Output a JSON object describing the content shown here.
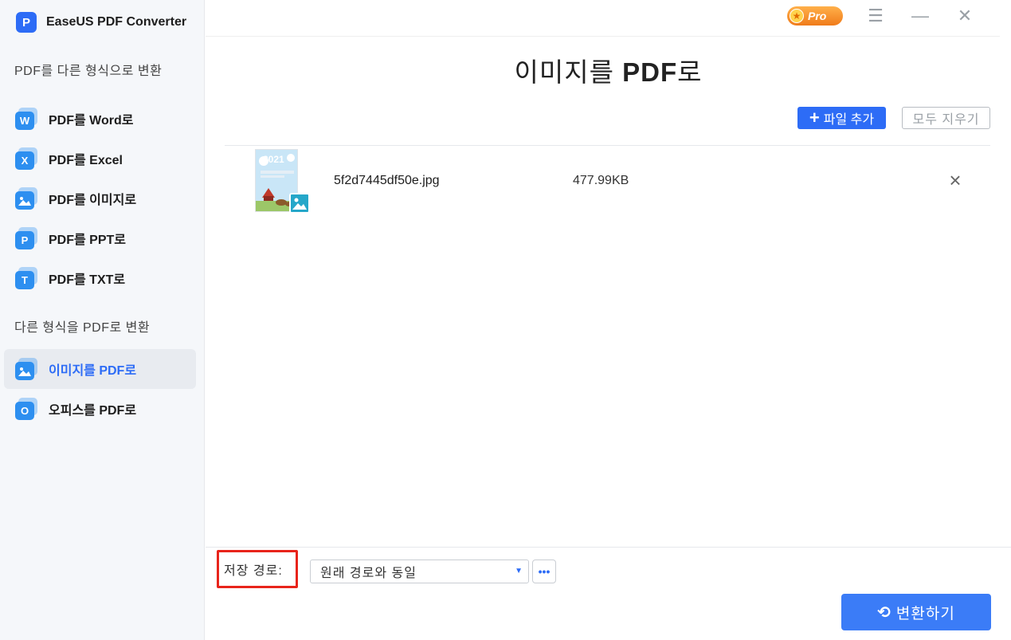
{
  "app": {
    "name": "EaseUS PDF Converter",
    "logo_letter": "P",
    "pro_label": "Pro"
  },
  "sidebar": {
    "section_from_pdf": "PDF를 다른 형식으로 변환",
    "section_to_pdf": "다른 형식을 PDF로 변환",
    "items": [
      {
        "label": "PDF를 Word로",
        "icon": "W",
        "icon_name": "word-icon",
        "color": "#2d8ff0"
      },
      {
        "label": "PDF를 Excel",
        "icon": "X",
        "icon_name": "excel-icon",
        "color": "#2d8ff0"
      },
      {
        "label": "PDF를 이미지로",
        "icon": "",
        "icon_name": "image-icon",
        "color": "#2d8ff0"
      },
      {
        "label": "PDF를 PPT로",
        "icon": "P",
        "icon_name": "ppt-icon",
        "color": "#2d8ff0"
      },
      {
        "label": "PDF를 TXT로",
        "icon": "T",
        "icon_name": "txt-icon",
        "color": "#2d8ff0"
      },
      {
        "label": "이미지를 PDF로",
        "icon": "",
        "icon_name": "image-to-pdf-icon",
        "color": "#2d8ff0",
        "active": true
      },
      {
        "label": "오피스를 PDF로",
        "icon": "O",
        "icon_name": "office-icon",
        "color": "#2d8ff0"
      }
    ]
  },
  "main": {
    "title_normal": "이미지를 ",
    "title_bold": "PDF",
    "title_suffix": "로",
    "add_file_label": "파일 추가",
    "clear_all_label": "모두 지우기",
    "files": [
      {
        "name": "5f2d7445df50e.jpg",
        "size": "477.99KB",
        "thumb_text": "2021"
      }
    ],
    "save_path_label": "저장 경로:",
    "save_path_value": "원래 경로와 동일",
    "more_label": "•••",
    "convert_label": "변환하기"
  },
  "colors": {
    "accent": "#2d6cf6",
    "highlight_border": "#e8241b"
  }
}
